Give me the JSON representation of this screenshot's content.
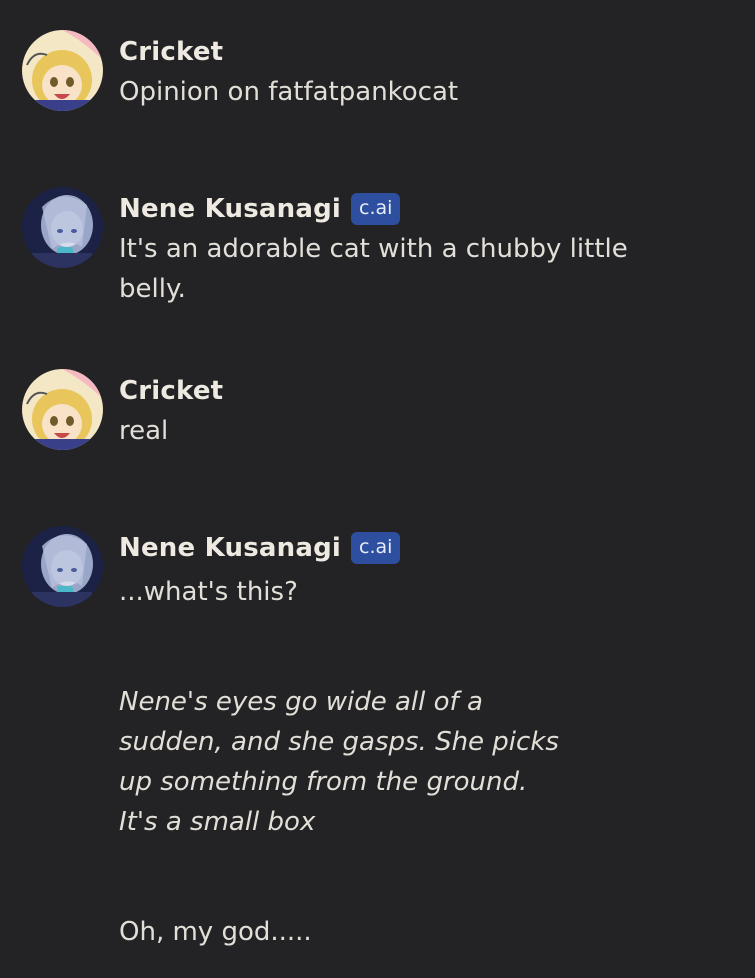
{
  "colors": {
    "background": "#232325",
    "badge": "#2e4f9f",
    "text": "#e2dfd8"
  },
  "messages": [
    {
      "author": "Cricket",
      "avatar_icon": "cricket-avatar",
      "badge": "",
      "text": "Opinion on fatfatpankocat"
    },
    {
      "author": "Nene Kusanagi",
      "avatar_icon": "nene-avatar",
      "badge": "c.ai",
      "text": "It's an adorable cat with a chubby little belly."
    },
    {
      "author": "Cricket",
      "avatar_icon": "cricket-avatar",
      "badge": "",
      "text": "real"
    },
    {
      "author": "Nene Kusanagi",
      "avatar_icon": "nene-avatar",
      "badge": "c.ai",
      "text": "...what's this?",
      "action": "Nene's eyes go wide all of a sudden, and she gasps. She picks up something from the ground. It's a small box",
      "followup": "Oh, my god....."
    }
  ]
}
